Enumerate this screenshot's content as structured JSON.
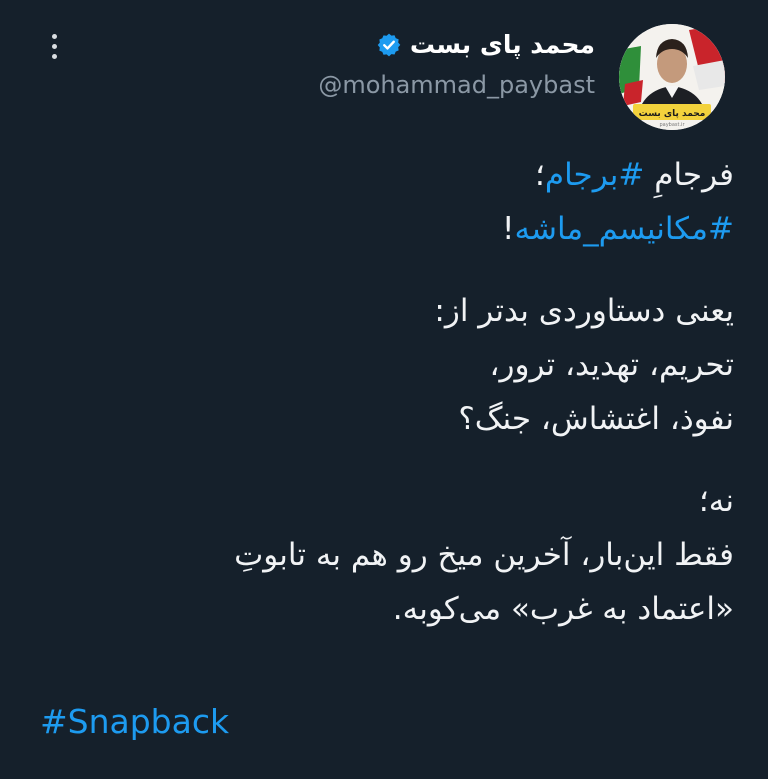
{
  "author": {
    "display_name": "محمد پای بست",
    "handle": "@mohammad_paybast",
    "verified": true
  },
  "avatar": {
    "banner_text": "محمد پای بست",
    "banner_subtext": "paybast.ir"
  },
  "tweet": {
    "line1_prefix": "فرجامِ",
    "line1_hashtag": "#برجام",
    "line1_suffix": "؛",
    "line2_hashtag": "#مکانیسم_ماشه",
    "line2_suffix": "!",
    "line3": "یعنی دستاوردی بدتر از:",
    "line4": "تحریم، تهدید، ترور،",
    "line5": "نفوذ، اغتشاش، جنگ؟",
    "line6": "نه؛",
    "line7": "فقط این‌بار، آخرین میخ رو هم به تابوتِ",
    "line8": "«اعتماد به غرب» می‌کوبه.",
    "footer_hashtag": "#Snapback"
  },
  "colors": {
    "background": "#15202b",
    "link": "#1d9bf0",
    "handle": "#8b98a5",
    "verified": "#1d9bf0"
  },
  "icons": [
    "more-vertical-icon",
    "verified-badge-icon"
  ]
}
